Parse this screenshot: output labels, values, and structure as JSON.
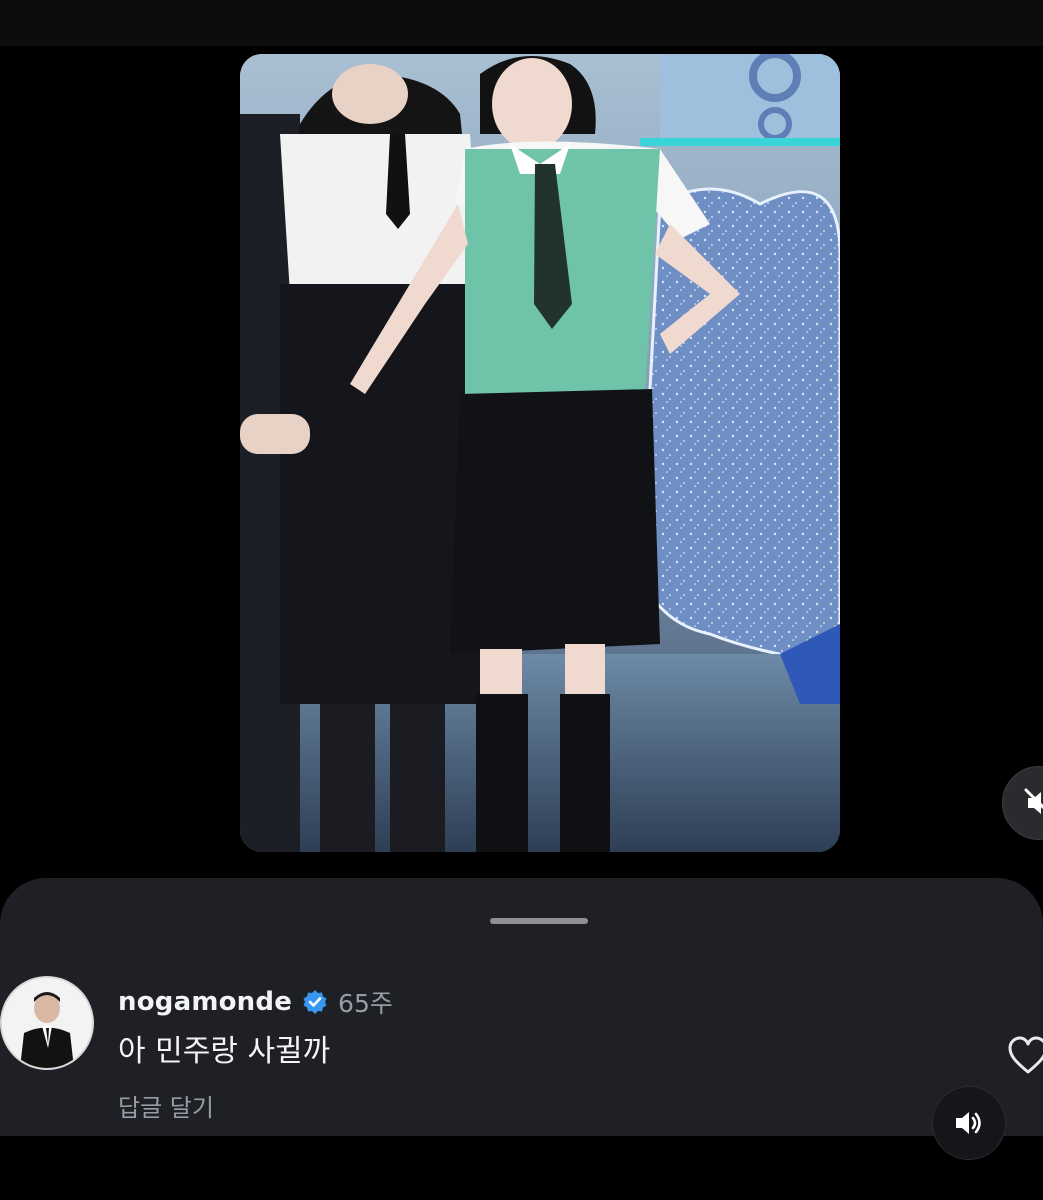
{
  "comment": {
    "username": "nogamonde",
    "time_ago": "65주",
    "text": "아 민주랑 사귈까",
    "reply_label": "답글 달기"
  },
  "icons": {
    "verified": "verified-badge-icon",
    "like": "heart-outline-icon",
    "muted": "speaker-muted-icon",
    "sound": "speaker-on-icon"
  },
  "colors": {
    "sheet_bg": "#1e2025",
    "verified_blue": "#3897f0",
    "secondary_text": "#9a9ca3"
  }
}
